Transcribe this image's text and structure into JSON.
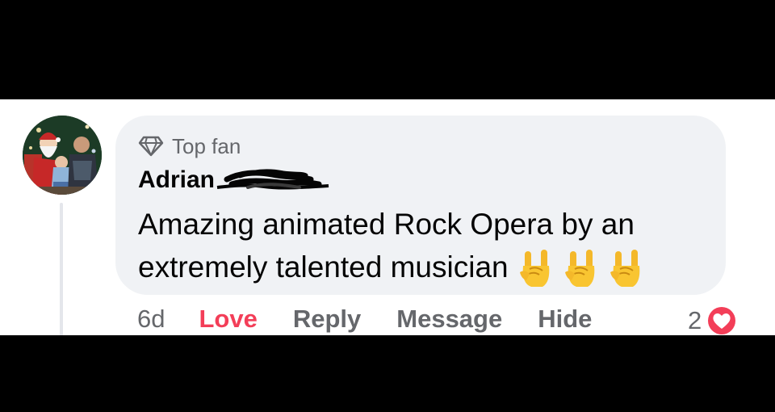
{
  "comment": {
    "badge_label": "Top fan",
    "badge_icon": "diamond-icon",
    "author_name": "Adrian",
    "author_surname_redacted": true,
    "text": "Amazing animated Rock Opera by an extremely talented musician",
    "emoji": [
      "sign-of-the-horns",
      "sign-of-the-horns",
      "sign-of-the-horns"
    ]
  },
  "actions": {
    "time_ago": "6d",
    "love_label": "Love",
    "reply_label": "Reply",
    "message_label": "Message",
    "hide_label": "Hide"
  },
  "reactions": {
    "count": "2",
    "type": "love",
    "icon": "heart-icon"
  },
  "colors": {
    "love": "#f33e58",
    "secondary_text": "#65676b",
    "primary_text": "#050505",
    "bubble": "#f0f2f5",
    "thread_line": "#e4e6eb"
  }
}
